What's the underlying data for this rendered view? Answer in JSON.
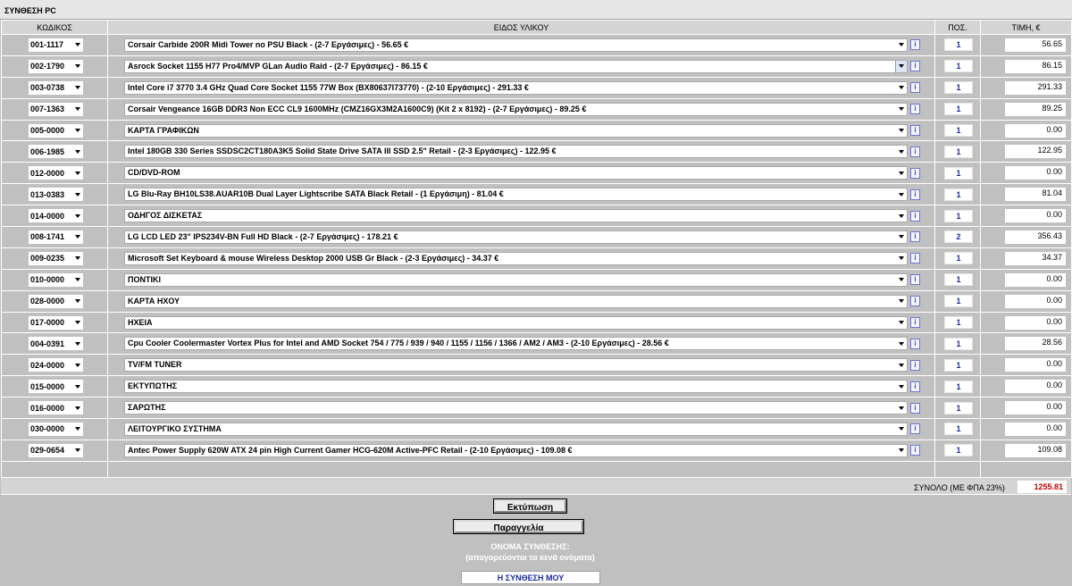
{
  "window": {
    "title": "ΣΥΝΘΕΣΗ PC"
  },
  "headers": {
    "code": "ΚΩΔΙΚΟΣ",
    "description": "ΕΙΔΟΣ ΥΛΙΚΟΥ",
    "quantity": "ΠΟΣ.",
    "price": "ΤΙΜΗ, €"
  },
  "info_label": "i",
  "rows": [
    {
      "code": "001-1117",
      "description": "Corsair Carbide 200R Midi Tower no PSU Black - (2-7 Εργάσιμες) - 56.65 €",
      "qty": "1",
      "price": "56.65"
    },
    {
      "code": "002-1790",
      "description": "Asrock Socket 1155 H77 Pro4/MVP GLan Audio Raid - (2-7 Εργάσιμες) - 86.15 €",
      "qty": "1",
      "price": "86.15"
    },
    {
      "code": "003-0738",
      "description": "Intel Core i7 3770 3.4 GHz Quad Core Socket 1155 77W Box (BX80637I73770) - (2-10 Εργάσιμες) - 291.33 €",
      "qty": "1",
      "price": "291.33"
    },
    {
      "code": "007-1363",
      "description": "Corsair Vengeance 16GB DDR3 Non ECC CL9 1600MHz (CMZ16GX3M2A1600C9) (Kit 2 x 8192) - (2-7 Εργάσιμες) - 89.25 €",
      "qty": "1",
      "price": "89.25"
    },
    {
      "code": "005-0000",
      "description": "ΚΑΡΤΑ ΓΡΑΦΙΚΩΝ",
      "qty": "1",
      "price": "0.00"
    },
    {
      "code": "006-1985",
      "description": "Intel 180GB 330 Series SSDSC2CT180A3K5 Solid State Drive SATA III SSD 2.5\" Retail - (2-3 Εργάσιμες) - 122.95 €",
      "qty": "1",
      "price": "122.95"
    },
    {
      "code": "012-0000",
      "description": "CD/DVD-ROM",
      "qty": "1",
      "price": "0.00"
    },
    {
      "code": "013-0383",
      "description": "LG Blu-Ray BH10LS38.AUAR10B Dual Layer Lightscribe SATA Black Retail - (1 Εργάσιμη) - 81.04 €",
      "qty": "1",
      "price": "81.04"
    },
    {
      "code": "014-0000",
      "description": "ΟΔΗΓΟΣ ΔΙΣΚΕΤΑΣ",
      "qty": "1",
      "price": "0.00"
    },
    {
      "code": "008-1741",
      "description": "LG LCD LED 23\" IPS234V-BN Full HD Black - (2-7 Εργάσιμες) - 178.21 €",
      "qty": "2",
      "price": "356.43"
    },
    {
      "code": "009-0235",
      "description": "Microsoft Set Keyboard & mouse Wireless Desktop 2000 USB Gr Black - (2-3 Εργάσιμες) - 34.37 €",
      "qty": "1",
      "price": "34.37"
    },
    {
      "code": "010-0000",
      "description": "ΠΟΝΤΙΚΙ",
      "qty": "1",
      "price": "0.00"
    },
    {
      "code": "028-0000",
      "description": "ΚΑΡΤΑ ΗΧΟΥ",
      "qty": "1",
      "price": "0.00"
    },
    {
      "code": "017-0000",
      "description": "ΗΧΕΙΑ",
      "qty": "1",
      "price": "0.00"
    },
    {
      "code": "004-0391",
      "description": "Cpu Cooler Coolermaster Vortex Plus for Intel and AMD Socket 754 / 775 / 939 / 940 / 1155 / 1156 / 1366 / AM2 / AM3 - (2-10 Εργάσιμες) - 28.56 €",
      "qty": "1",
      "price": "28.56"
    },
    {
      "code": "024-0000",
      "description": "TV/FM TUNER",
      "qty": "1",
      "price": "0.00"
    },
    {
      "code": "015-0000",
      "description": "ΕΚΤΥΠΩΤΗΣ",
      "qty": "1",
      "price": "0.00"
    },
    {
      "code": "016-0000",
      "description": "ΣΑΡΩΤΗΣ",
      "qty": "1",
      "price": "0.00"
    },
    {
      "code": "030-0000",
      "description": "ΛΕΙΤΟΥΡΓΙΚΟ ΣΥΣΤΗΜΑ",
      "qty": "1",
      "price": "0.00"
    },
    {
      "code": "029-0654",
      "description": "Antec Power Supply 620W ATX 24 pin High Current Gamer HCG-620M Active-PFC Retail - (2-10 Εργάσιμες) - 109.08 €",
      "qty": "1",
      "price": "109.08"
    }
  ],
  "total": {
    "label": "ΣΥΝΟΛΟ (ΜΕ ΦΠΑ 23%)",
    "value": "1255.81"
  },
  "buttons": {
    "print": "Εκτύπωση",
    "order": "Παραγγελία"
  },
  "composition_name": {
    "title": "ΟΝΟΜΑ ΣΥΝΘΕΣΗΣ:",
    "hint": "(απαγορεύονται τα κενά ονόματα)",
    "value": "Η ΣΥΝΘΕΣΗ ΜΟΥ"
  },
  "colors": {
    "background": "#c0c0c0",
    "total_value": "#c00000",
    "qty_text": "#1a2aa0"
  }
}
